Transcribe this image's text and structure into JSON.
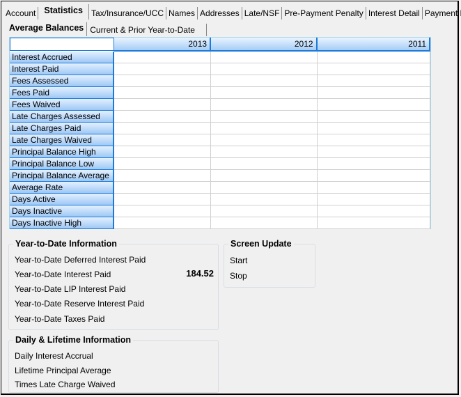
{
  "main_tabs": [
    {
      "label": "Account",
      "active": false
    },
    {
      "label": "Statistics",
      "active": true
    },
    {
      "label": "Tax/Insurance/UCC",
      "active": false
    },
    {
      "label": "Names",
      "active": false
    },
    {
      "label": "Addresses",
      "active": false
    },
    {
      "label": "Late/NSF",
      "active": false
    },
    {
      "label": "Pre-Payment Penalty",
      "active": false
    },
    {
      "label": "Interest Detail",
      "active": false
    },
    {
      "label": "Payment Detail",
      "active": false
    }
  ],
  "sub_tabs": [
    {
      "label": "Average Balances",
      "active": true
    },
    {
      "label": "Current & Prior Year-to-Date",
      "active": false
    }
  ],
  "grid": {
    "columns": [
      "2013",
      "2012",
      "2011"
    ],
    "rows": [
      {
        "label": "Interest Accrued",
        "values": [
          "",
          "",
          ""
        ]
      },
      {
        "label": "Interest Paid",
        "values": [
          "",
          "",
          ""
        ]
      },
      {
        "label": "Fees Assessed",
        "values": [
          "",
          "",
          ""
        ]
      },
      {
        "label": "Fees Paid",
        "values": [
          "",
          "",
          ""
        ]
      },
      {
        "label": "Fees Waived",
        "values": [
          "",
          "",
          ""
        ]
      },
      {
        "label": "Late Charges Assessed",
        "values": [
          "",
          "",
          ""
        ]
      },
      {
        "label": "Late Charges Paid",
        "values": [
          "",
          "",
          ""
        ]
      },
      {
        "label": "Late Charges Waived",
        "values": [
          "",
          "",
          ""
        ]
      },
      {
        "label": "Principal Balance High",
        "values": [
          "",
          "",
          ""
        ]
      },
      {
        "label": "Principal Balance Low",
        "values": [
          "",
          "",
          ""
        ]
      },
      {
        "label": "Principal Balance Average",
        "values": [
          "",
          "",
          ""
        ]
      },
      {
        "label": "Average Rate",
        "values": [
          "",
          "",
          ""
        ]
      },
      {
        "label": "Days Active",
        "values": [
          "",
          "",
          ""
        ]
      },
      {
        "label": "Days Inactive",
        "values": [
          "",
          "",
          ""
        ]
      },
      {
        "label": "Days Inactive High",
        "values": [
          "",
          "",
          ""
        ]
      }
    ]
  },
  "ytd": {
    "title": "Year-to-Date Information",
    "fields": [
      {
        "label": "Year-to-Date Deferred Interest Paid",
        "value": ""
      },
      {
        "label": "Year-to-Date Interest Paid",
        "value": "184.52"
      },
      {
        "label": "Year-to-Date LIP Interest Paid",
        "value": ""
      },
      {
        "label": "Year-to-Date Reserve Interest Paid",
        "value": ""
      },
      {
        "label": "Year-to-Date Taxes Paid",
        "value": ""
      }
    ]
  },
  "screen_update": {
    "title": "Screen Update",
    "fields": [
      {
        "label": "Start",
        "value": ""
      },
      {
        "label": "Stop",
        "value": ""
      }
    ]
  },
  "daily": {
    "title": "Daily & Lifetime Information",
    "fields": [
      {
        "label": "Daily Interest Accrual",
        "value": ""
      },
      {
        "label": "Lifetime Principal Average",
        "value": ""
      },
      {
        "label": "Times Late Charge Waived",
        "value": ""
      }
    ]
  }
}
